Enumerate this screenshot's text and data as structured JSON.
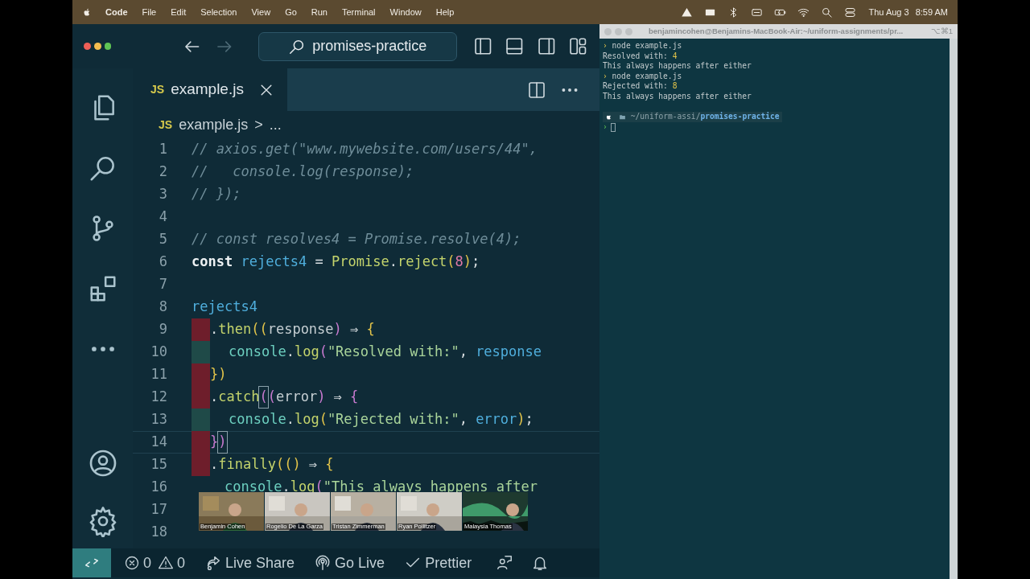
{
  "menu_bar": {
    "app": "Code",
    "items": [
      "File",
      "Edit",
      "Selection",
      "View",
      "Go",
      "Run",
      "Terminal",
      "Window",
      "Help"
    ],
    "date": "Thu Aug 3",
    "time": "8:59 AM"
  },
  "editor": {
    "search": "promises-practice",
    "tab": {
      "badge": "JS",
      "label": "example.js"
    },
    "breadcrumb": {
      "badge": "JS",
      "file": "example.js",
      "sep": ">",
      "more": "..."
    },
    "lines": [
      {
        "number": "1",
        "current": false,
        "tokens": [
          {
            "kind": "comment",
            "text": "// axios.get(\"www.mywebsite.com/users/44\","
          }
        ]
      },
      {
        "number": "2",
        "current": false,
        "tokens": [
          {
            "kind": "comment",
            "text": "//   console.log(response);"
          }
        ]
      },
      {
        "number": "3",
        "current": false,
        "tokens": [
          {
            "kind": "comment",
            "text": "// });"
          }
        ]
      },
      {
        "number": "4",
        "current": false
      },
      {
        "number": "5",
        "current": false,
        "tokens": [
          {
            "kind": "comment",
            "text": "// const resolves4 = Promise.resolve(4);"
          }
        ]
      },
      {
        "number": "6",
        "current": false,
        "tokens": [
          {
            "kind": "keyword",
            "text": "const"
          },
          {
            "kind": "var",
            "text": " rejects4"
          },
          {
            "kind": "plain",
            "text": " = "
          },
          {
            "kind": "class",
            "text": "Promise"
          },
          {
            "kind": "plain",
            "text": "."
          },
          {
            "kind": "func",
            "text": "reject"
          },
          {
            "kind": "bracket",
            "text": "("
          },
          {
            "kind": "number",
            "text": "8"
          },
          {
            "kind": "bracket",
            "text": ")"
          },
          {
            "kind": "plain",
            "text": ";"
          }
        ]
      },
      {
        "number": "7",
        "current": false
      },
      {
        "number": "8",
        "current": false,
        "tokens": [
          {
            "kind": "var",
            "text": "rejects4"
          }
        ]
      },
      {
        "number": "9",
        "current": false,
        "color": "#6e1e2b",
        "tokens": [
          {
            "kind": "plain",
            "text": "."
          },
          {
            "kind": "func",
            "text": "then"
          },
          {
            "kind": "bracket",
            "text": "(("
          },
          {
            "kind": "param",
            "text": "response"
          },
          {
            "kind": "bracket2",
            "text": ")"
          },
          {
            "kind": "plain",
            "text": " ⇒ "
          },
          {
            "kind": "bracket",
            "text": "{"
          }
        ]
      },
      {
        "number": "10",
        "current": false,
        "color": "#1f4a48",
        "tokens": [
          {
            "kind": "object",
            "text": "console"
          },
          {
            "kind": "plain",
            "text": "."
          },
          {
            "kind": "func",
            "text": "log"
          },
          {
            "kind": "bracket2",
            "text": "("
          },
          {
            "kind": "string",
            "text": "\"Resolved with:\""
          },
          {
            "kind": "plain",
            "text": ", "
          },
          {
            "kind": "var",
            "text": "response"
          }
        ]
      },
      {
        "number": "11",
        "current": false,
        "color": "#6e1e2b",
        "tokens": [
          {
            "kind": "bracket",
            "text": "})"
          }
        ]
      },
      {
        "number": "12",
        "current": false,
        "color": "#6e1e2b",
        "tokens": [
          {
            "kind": "plain",
            "text": "."
          },
          {
            "kind": "func",
            "text": "catch"
          },
          {
            "kind": "match",
            "text": "("
          },
          {
            "kind": "bracket2",
            "text": "("
          },
          {
            "kind": "param",
            "text": "error"
          },
          {
            "kind": "bracket2",
            "text": ")"
          },
          {
            "kind": "plain",
            "text": " ⇒ "
          },
          {
            "kind": "bracket2",
            "text": "{"
          }
        ]
      },
      {
        "number": "13",
        "current": false,
        "color": "#1f4a48",
        "tokens": [
          {
            "kind": "object",
            "text": "console"
          },
          {
            "kind": "plain",
            "text": "."
          },
          {
            "kind": "func",
            "text": "log"
          },
          {
            "kind": "bracket",
            "text": "("
          },
          {
            "kind": "string",
            "text": "\"Rejected with:\""
          },
          {
            "kind": "plain",
            "text": ", "
          },
          {
            "kind": "var",
            "text": "error"
          },
          {
            "kind": "bracket",
            "text": ")"
          },
          {
            "kind": "plain",
            "text": ";"
          }
        ]
      },
      {
        "number": "14",
        "current": true,
        "color": "#6e1e2b",
        "tokens": [
          {
            "kind": "bracket2",
            "text": "}"
          },
          {
            "kind": "match",
            "text": ")"
          }
        ]
      },
      {
        "number": "15",
        "current": false,
        "color": "#6e1e2b",
        "tokens": [
          {
            "kind": "plain",
            "text": "."
          },
          {
            "kind": "func",
            "text": "finally"
          },
          {
            "kind": "bracket",
            "text": "(()"
          },
          {
            "kind": "plain",
            "text": " ⇒ "
          },
          {
            "kind": "bracket",
            "text": "{"
          }
        ]
      },
      {
        "number": "16",
        "current": false,
        "tokens": [
          {
            "kind": "object",
            "text": "    console"
          },
          {
            "kind": "plain",
            "text": "."
          },
          {
            "kind": "func",
            "text": "log"
          },
          {
            "kind": "bracket2",
            "text": "("
          },
          {
            "kind": "string",
            "text": "\"This always happens after"
          }
        ]
      },
      {
        "number": "17",
        "current": false
      },
      {
        "number": "18",
        "current": false
      }
    ]
  },
  "participants": [
    {
      "name": "Benjamin Cohen",
      "kind": "picture"
    },
    {
      "name": "Rogelio De La Garza",
      "kind": "picture"
    },
    {
      "name": "Tristan Zimmerman",
      "kind": "picture"
    },
    {
      "name": "Ryan Pollitzer",
      "kind": "picture"
    },
    {
      "name": "Malaysia Thomas",
      "kind": "picture"
    }
  ],
  "status_bar": {
    "errors": "0",
    "warnings": "0",
    "items": [
      {
        "kind": "liveshare",
        "label": "Live Share"
      },
      {
        "kind": "golive",
        "label": "Go Live"
      },
      {
        "kind": "prettier",
        "label": "Prettier"
      }
    ]
  },
  "terminal": {
    "title": "benjamincohen@Benjamins-MacBook-Air:~/uniform-assignments/pr...",
    "shortcut": "⌥⌘1",
    "lines": [
      {
        "kind": "command",
        "prompt": "›",
        "text": "node example.js"
      },
      {
        "kind": "output",
        "text": "Resolved with: ",
        "value": "4"
      },
      {
        "kind": "output",
        "text": "This always happens after either"
      },
      {
        "kind": "command",
        "prompt": "›",
        "text": "node example.js"
      },
      {
        "kind": "output",
        "text": "Rejected with: ",
        "value": "8"
      },
      {
        "kind": "output",
        "text": "This always happens after either"
      }
    ],
    "path_dim": "~/uniform-assi/",
    "path_bold": "promises-practice",
    "cursor_prompt": "›"
  }
}
